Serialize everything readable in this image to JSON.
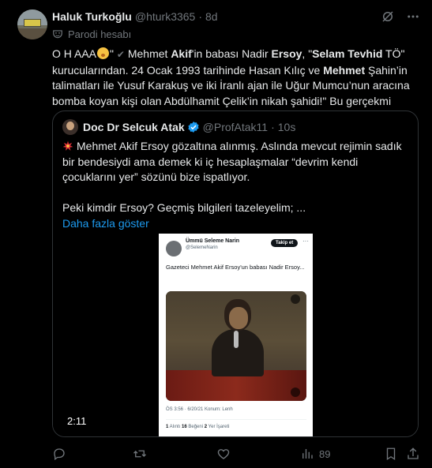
{
  "tweet": {
    "author_name": "Haluk Turkoğlu",
    "author_handle": "@hturk3365",
    "separator": "·",
    "time": "8d",
    "parody_label": "Parodi hesabı",
    "body": {
      "t1": "O H AAA",
      "t2": "\" ",
      "t3": "✔",
      "t4": " Mehmet ",
      "b1": "Akif",
      "t5": "'in babası Nadir ",
      "b2": "Ersoy",
      "t6": ", \"",
      "b3": "Selam Tevhid",
      "t7": " TÖ\" kurucularından. 24 Ocak 1993 tarihinde Hasan Kılıç ve ",
      "b4": "Mehmet",
      "t8": " Şahin’in talimatları ile Yusuf Karakuş ve iki İranlı ajan ile Uğur Mumcu’nun aracına bomba koyan kişi olan Abdülhamit Çelik’in nikah şahidi!\" Bu gerçekmi"
    }
  },
  "quote": {
    "author_name": "Doc Dr Selcuk Atak",
    "author_handle": "@ProfAtak11",
    "separator": "·",
    "time": "10s",
    "paragraph1": "Mehmet Akif Ersoy gözaltına alınmış. Aslında mevcut rejimin sadık bir bendesiydi ama demek ki iç hesaplaşmalar “devrim kendi çocuklarını yer” sözünü bize ispatlıyor.",
    "paragraph2": "Peki kimdir Ersoy? Geçmiş bilgileri tazeleyelim; ...",
    "show_more": "Daha fazla göster",
    "video": {
      "duration": "2:11",
      "inner_post": {
        "name": "Ümmü Seleme Narin",
        "handle": "@SelemeNarin",
        "follow": "Takip et",
        "dots": "···",
        "text": "Gazeteci Mehmet  Akif Ersoy'un babası Nadir Ersoy...",
        "meta": "ÖS 3:56 · 6/20/21 Konum: Lenh",
        "stats_num1": "1",
        "stats_lbl1": " Alıntı  ",
        "stats_num2": "16",
        "stats_lbl2": " Beğeni  ",
        "stats_num3": "2",
        "stats_lbl3": " Yer İşareti"
      }
    }
  },
  "actions": {
    "views": "89"
  },
  "colors": {
    "background": "#000000",
    "text": "#e7e9ea",
    "muted": "#71767b",
    "link": "#1d9bf0",
    "border": "#2f3336"
  },
  "icons": [
    "grok-icon",
    "more-icon",
    "parody-mask-icon",
    "verified-badge-icon",
    "collision-emoji-icon",
    "reply-icon",
    "retweet-icon",
    "like-icon",
    "views-icon",
    "bookmark-icon",
    "share-icon"
  ]
}
